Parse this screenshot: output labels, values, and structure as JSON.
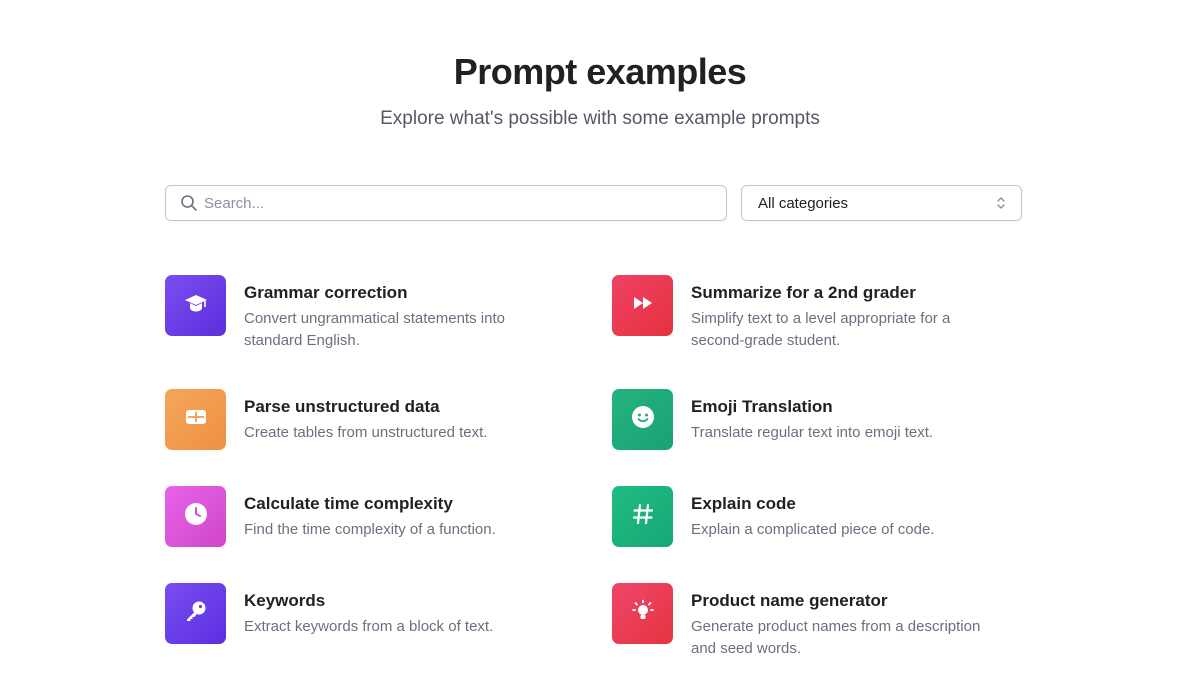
{
  "header": {
    "title": "Prompt examples",
    "subtitle": "Explore what's possible with some example prompts"
  },
  "search": {
    "placeholder": "Search...",
    "value": ""
  },
  "category_select": {
    "value": "All categories"
  },
  "examples": [
    {
      "name": "Grammar correction",
      "desc_line1": "Convert ungrammatical statements into",
      "desc_line2": "standard English.",
      "icon": "graduation-cap-icon",
      "color": "#6a3ee8"
    },
    {
      "name": "Summarize for a 2nd grader",
      "desc_line1": "Simplify text to a level appropriate for a",
      "desc_line2": "second-grade student.",
      "icon": "fast-forward-icon",
      "color": "#ea3b52"
    },
    {
      "name": "Parse unstructured data",
      "desc_line1": "Create tables from unstructured text.",
      "desc_line2": "",
      "icon": "table-icon",
      "color": "#f19d4f"
    },
    {
      "name": "Emoji Translation",
      "desc_line1": "Translate regular text into emoji text.",
      "desc_line2": "",
      "icon": "smiley-icon",
      "color": "#1faa79"
    },
    {
      "name": "Calculate time complexity",
      "desc_line1": "Find the time complexity of a function.",
      "desc_line2": "",
      "icon": "clock-icon",
      "color": "#dc55d9"
    },
    {
      "name": "Explain code",
      "desc_line1": "Explain a complicated piece of code.",
      "desc_line2": "",
      "icon": "hashtag-icon",
      "color": "#1cb17c"
    },
    {
      "name": "Keywords",
      "desc_line1": "Extract keywords from a block of text.",
      "desc_line2": "",
      "icon": "key-icon",
      "color": "#6a3ee8"
    },
    {
      "name": "Product name generator",
      "desc_line1": "Generate product names from a description",
      "desc_line2": "and seed words.",
      "icon": "lightbulb-icon",
      "color": "#ea3d55"
    }
  ]
}
